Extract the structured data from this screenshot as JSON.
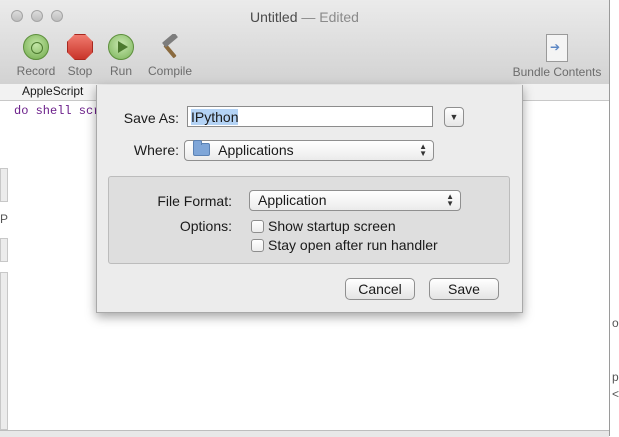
{
  "window": {
    "title": "Untitled",
    "title_suffix": "— Edited"
  },
  "toolbar": {
    "record_label": "Record",
    "stop_label": "Stop",
    "run_label": "Run",
    "compile_label": "Compile",
    "bundle_label": "Bundle Contents"
  },
  "editor": {
    "language": "AppleScript",
    "code_line": "do shell scr"
  },
  "background_glyphs": [
    "P",
    "o",
    "p",
    "<"
  ],
  "dialog": {
    "save_as_label": "Save As:",
    "save_as_value": "IPython",
    "where_label": "Where:",
    "where_value": "Applications",
    "file_format_label": "File Format:",
    "file_format_value": "Application",
    "options_label": "Options:",
    "option_startup": "Show startup screen",
    "option_stay_open": "Stay open after run handler",
    "cancel_label": "Cancel",
    "save_label": "Save"
  }
}
